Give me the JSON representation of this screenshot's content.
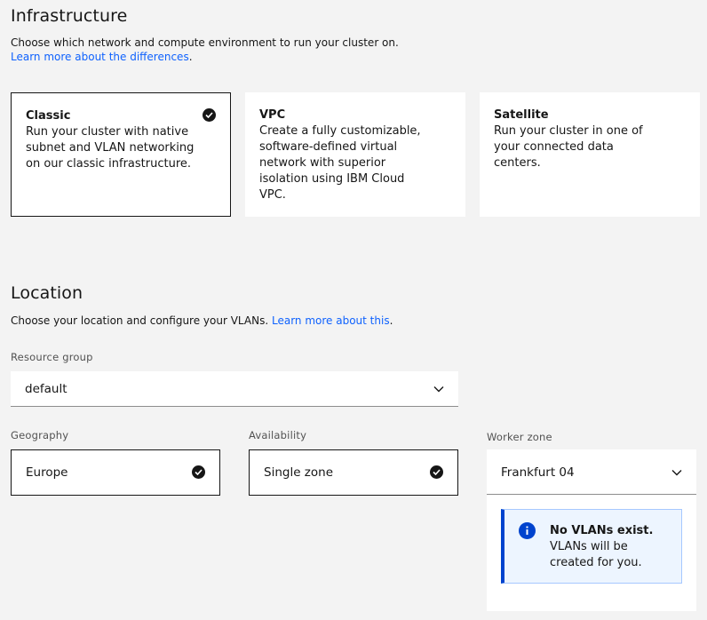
{
  "infrastructure": {
    "title": "Infrastructure",
    "description": "Choose which network and compute environment to run your cluster on.",
    "learn_more_link": "Learn more about the differences",
    "learn_more_suffix": ".",
    "tiles": [
      {
        "title": "Classic",
        "description": "Run your cluster with native subnet and VLAN networking on our classic infrastructure.",
        "selected": true
      },
      {
        "title": "VPC",
        "description": "Create a fully customizable, software-defined virtual network with superior isolation using IBM Cloud VPC.",
        "selected": false
      },
      {
        "title": "Satellite",
        "description": "Run your cluster in one of your connected data centers.",
        "selected": false
      }
    ]
  },
  "location": {
    "title": "Location",
    "description": "Choose your location and configure your VLANs.",
    "learn_more_link": "Learn more about this",
    "learn_more_suffix": ".",
    "resource_group": {
      "label": "Resource group",
      "value": "default"
    },
    "geography": {
      "label": "Geography",
      "value": "Europe"
    },
    "availability": {
      "label": "Availability",
      "value": "Single zone"
    },
    "worker_zone": {
      "label": "Worker zone",
      "value": "Frankfurt 04"
    },
    "notification": {
      "title": "No VLANs exist.",
      "body": "VLANs will be created for you."
    }
  },
  "colors": {
    "background": "#f3f3f3",
    "tile": "#ffffff",
    "link": "#0f62fe",
    "info_accent": "#0043ce",
    "info_background": "#edf5ff"
  }
}
